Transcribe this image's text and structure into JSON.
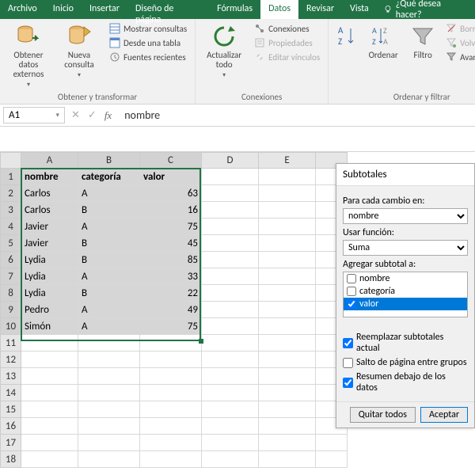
{
  "menubar": {
    "items": [
      "Archivo",
      "Inicio",
      "Insertar",
      "Diseño de página",
      "Fórmulas",
      "Datos",
      "Revisar",
      "Vista"
    ],
    "active_index": 5,
    "tellme": "¿Qué desea hacer?"
  },
  "ribbon": {
    "group1": {
      "btn1": "Obtener datos\nexternos",
      "btn2": "Nueva\nconsulta",
      "s1": "Mostrar consultas",
      "s2": "Desde una tabla",
      "s3": "Fuentes recientes",
      "label": "Obtener y transformar"
    },
    "group2": {
      "btn": "Actualizar\ntodo",
      "s1": "Conexiones",
      "s2": "Propiedades",
      "s3": "Editar vínculos",
      "label": "Conexiones"
    },
    "group3": {
      "sort": "Ordenar",
      "filter": "Filtro",
      "s1": "Borrar",
      "s2": "Volver a aplic",
      "s3": "Avanzadas",
      "label": "Ordenar y filtrar"
    }
  },
  "namebox": "A1",
  "formula": "nombre",
  "columns": [
    "A",
    "B",
    "C",
    "D",
    "E"
  ],
  "headers": {
    "c1": "nombre",
    "c2": "categoría",
    "c3": "valor"
  },
  "rows": [
    {
      "n": "Carlos",
      "c": "A",
      "v": 63
    },
    {
      "n": "Carlos",
      "c": "B",
      "v": 16
    },
    {
      "n": "Javier",
      "c": "A",
      "v": 75
    },
    {
      "n": "Javier",
      "c": "B",
      "v": 45
    },
    {
      "n": "Lydia",
      "c": "B",
      "v": 85
    },
    {
      "n": "Lydia",
      "c": "A",
      "v": 33
    },
    {
      "n": "Lydia",
      "c": "B",
      "v": 22
    },
    {
      "n": "Pedro",
      "c": "A",
      "v": 49
    },
    {
      "n": "Simón",
      "c": "A",
      "v": 75
    }
  ],
  "dialog": {
    "title": "Subtotales",
    "l_foreach": "Para cada cambio en:",
    "v_foreach": "nombre",
    "l_func": "Usar función:",
    "v_func": "Suma",
    "l_addto": "Agregar subtotal a:",
    "opts": [
      "nombre",
      "categoría",
      "valor"
    ],
    "checked_index": 2,
    "chk1": "Reemplazar subtotales actual",
    "chk2": "Salto de página entre grupos",
    "chk3": "Resumen debajo de los datos",
    "chk1_on": true,
    "chk2_on": false,
    "chk3_on": true,
    "btn_removeall": "Quitar todos",
    "btn_ok": "Aceptar"
  }
}
